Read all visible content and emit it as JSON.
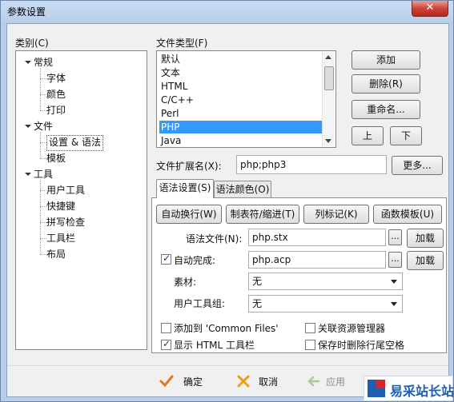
{
  "window": {
    "title": "参数设置",
    "close_label": "✕"
  },
  "category": {
    "label": "类别(C)",
    "tree": [
      {
        "label": "常规",
        "level": 0,
        "expanded": true
      },
      {
        "label": "字体",
        "level": 1
      },
      {
        "label": "颜色",
        "level": 1
      },
      {
        "label": "打印",
        "level": 1
      },
      {
        "label": "文件",
        "level": 0,
        "expanded": true
      },
      {
        "label": "设置 & 语法",
        "level": 1,
        "selected": true
      },
      {
        "label": "模板",
        "level": 1
      },
      {
        "label": "工具",
        "level": 0,
        "expanded": true
      },
      {
        "label": "用户工具",
        "level": 1
      },
      {
        "label": "快捷键",
        "level": 1
      },
      {
        "label": "拼写检查",
        "level": 1
      },
      {
        "label": "工具栏",
        "level": 1
      },
      {
        "label": "布局",
        "level": 1
      }
    ]
  },
  "filetype": {
    "label": "文件类型(F)",
    "items": [
      "默认",
      "文本",
      "HTML",
      "C/C++",
      "Perl",
      "PHP",
      "Java"
    ],
    "selected": "PHP",
    "buttons": {
      "add": "添加",
      "delete": "删除(R)",
      "rename": "重命名...",
      "up": "上",
      "down": "下"
    }
  },
  "extension": {
    "label": "文件扩展名(X):",
    "value": "php;php3",
    "more": "更多..."
  },
  "tabs": [
    {
      "label": "语法设置(S)",
      "active": true
    },
    {
      "label": "语法颜色(O)",
      "active": false
    }
  ],
  "syntax": {
    "buttons": [
      "自动换行(W)",
      "制表符/缩进(T)",
      "列标记(K)",
      "函数模板(U)"
    ],
    "syntax_file": {
      "label": "语法文件(N):",
      "value": "php.stx",
      "browse": "...",
      "load": "加载"
    },
    "autocomplete": {
      "label": "自动完成:",
      "checked": true,
      "value": "php.acp",
      "browse": "...",
      "load": "加载"
    },
    "material": {
      "label": "素材:",
      "value": "无"
    },
    "usertool_group": {
      "label": "用户工具组:",
      "value": "无"
    },
    "options": [
      {
        "label": "添加到 'Common Files'",
        "checked": false
      },
      {
        "label": "关联资源管理器",
        "checked": false
      },
      {
        "label": "显示 HTML 工具栏",
        "checked": true
      },
      {
        "label": "保存时删除行尾空格",
        "checked": false
      }
    ]
  },
  "footer": {
    "ok": "确定",
    "cancel": "取消",
    "apply": "应用"
  },
  "watermark": {
    "text": "易采站长站",
    "colors": {
      "blue": "#1c5fb3",
      "red": "#d5262b"
    }
  },
  "colors": {
    "selection": "#3399ff",
    "accent": "#1c5fb3"
  }
}
